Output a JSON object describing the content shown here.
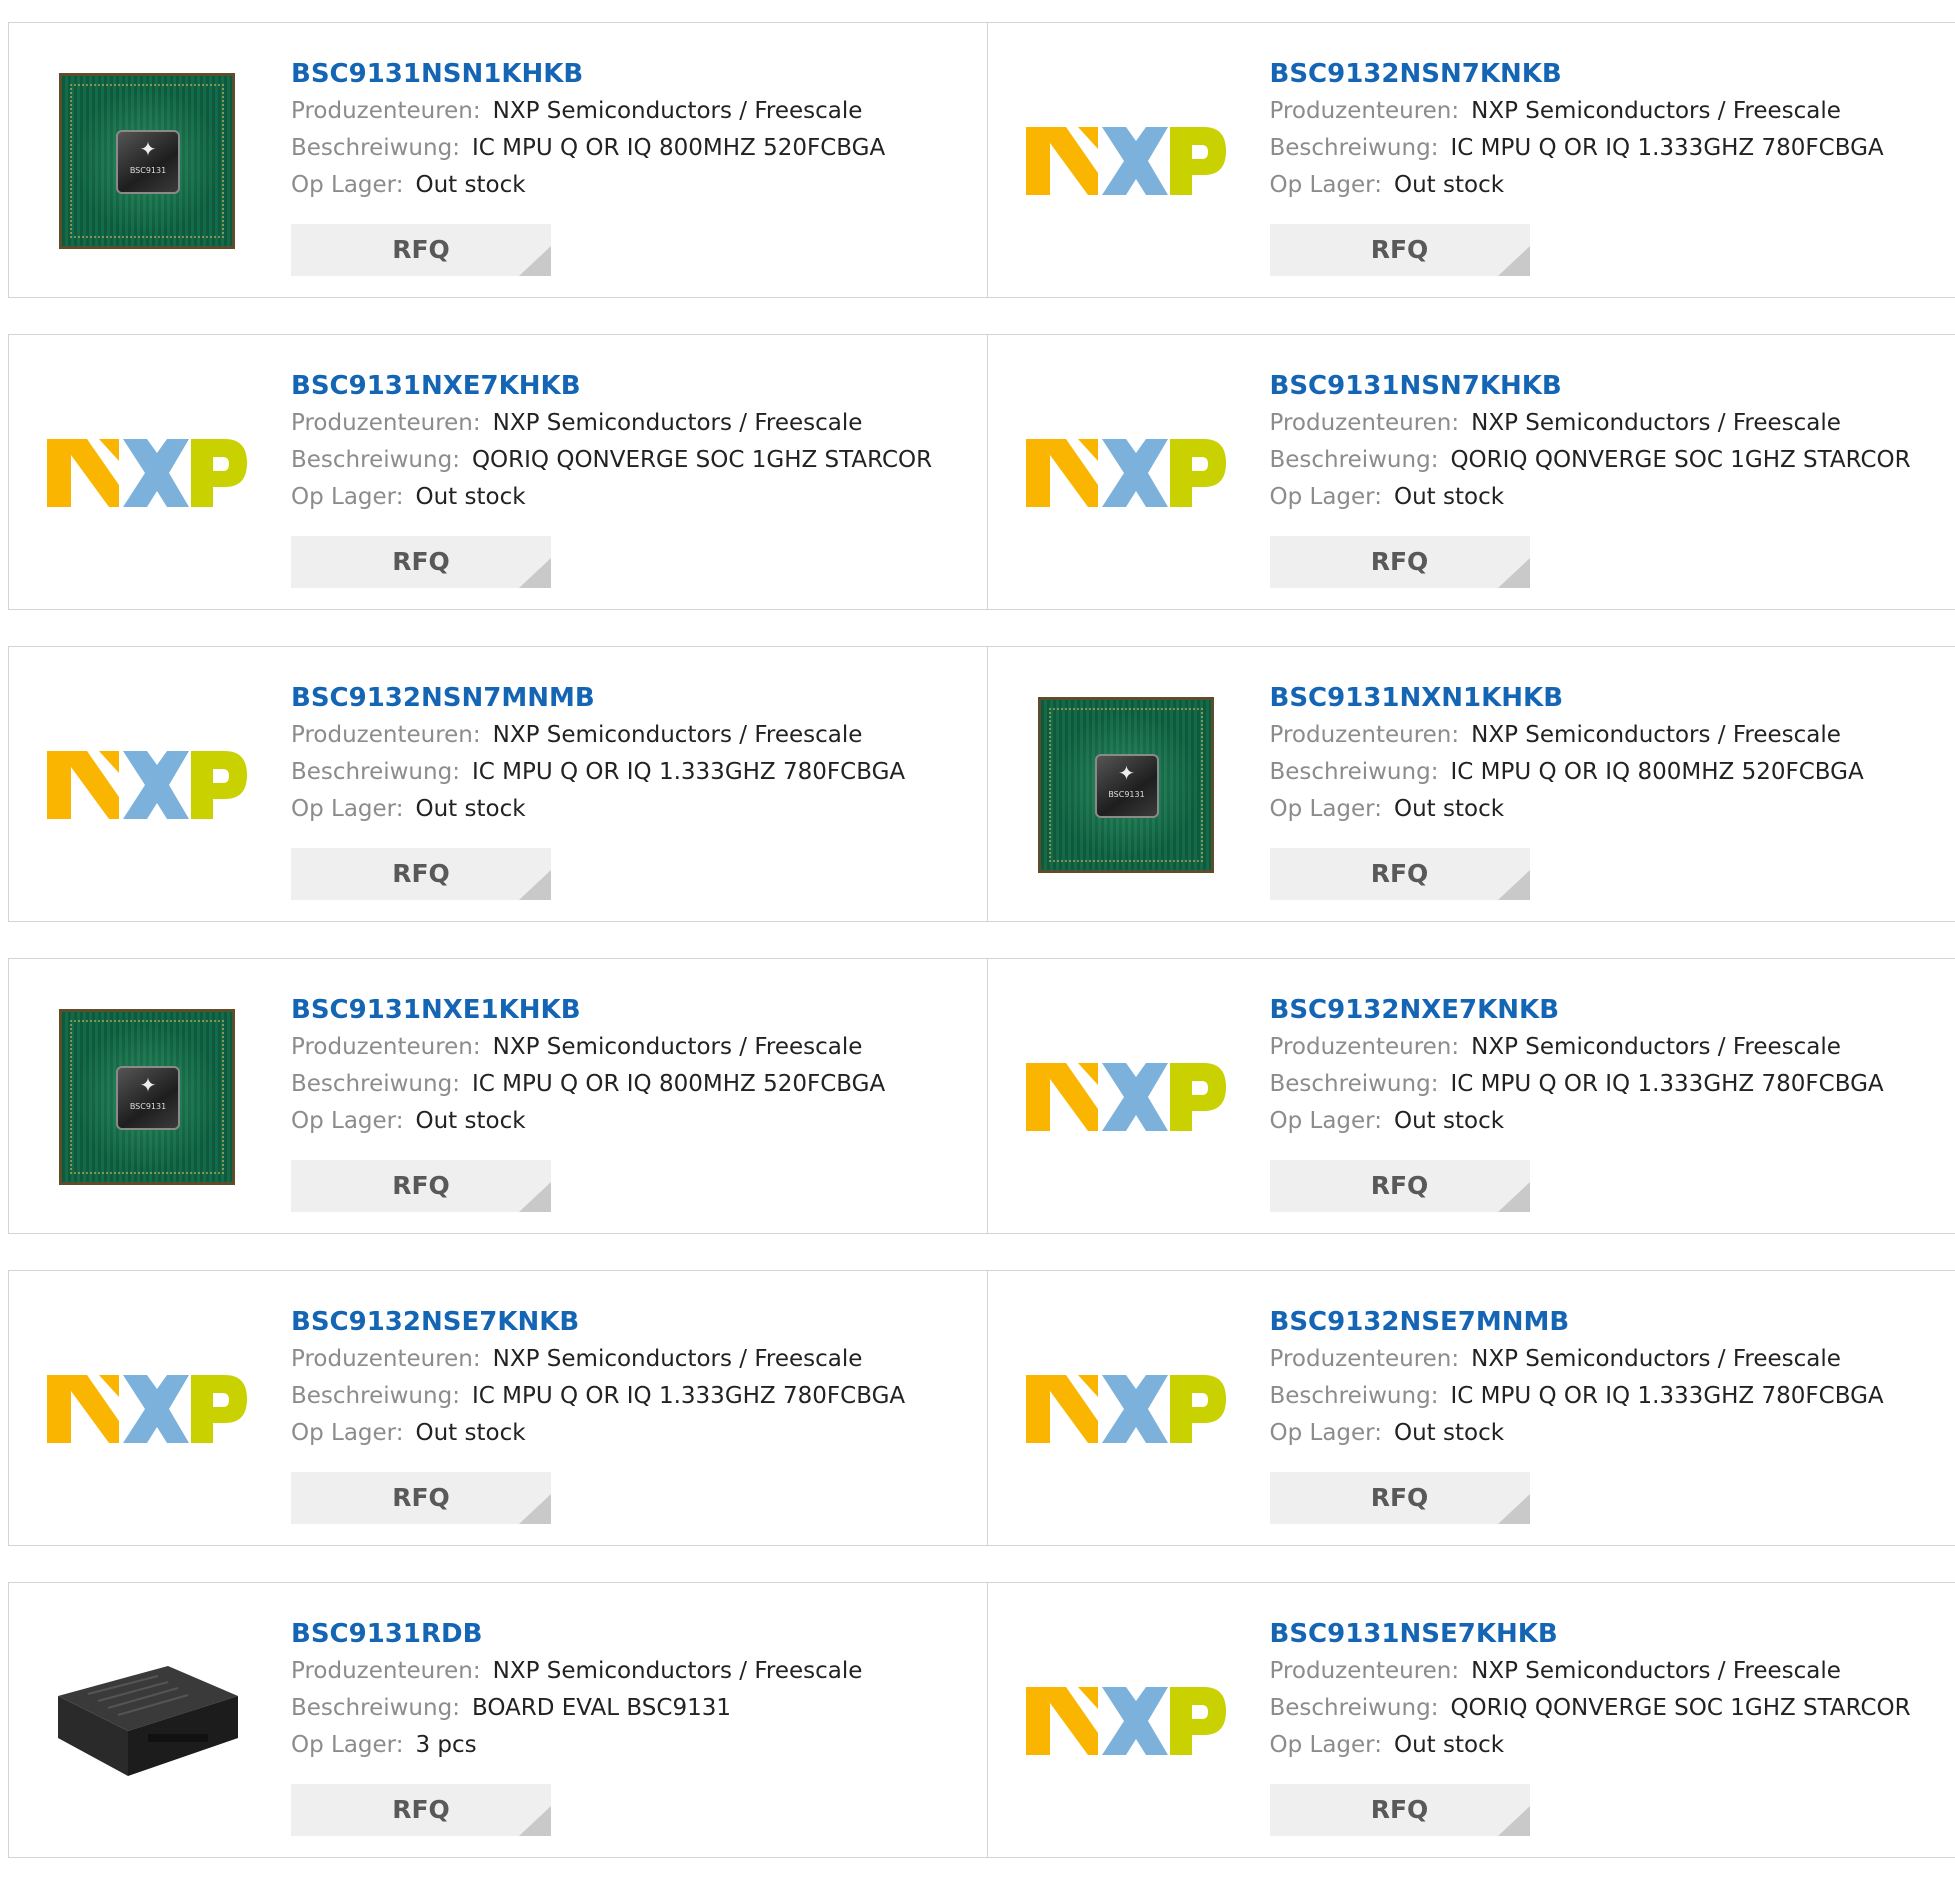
{
  "labels": {
    "manufacturer": "Produzenteuren:",
    "description": "Beschreiwung:",
    "stock": "Op Lager:",
    "rfq": "RFQ"
  },
  "chip_marking": "BSC9131",
  "products": [
    {
      "part": "BSC9131NSN1KHKB",
      "manufacturer": "NXP Semiconductors / Freescale",
      "description": "IC MPU Q OR IQ 800MHZ 520FCBGA",
      "stock": "Out stock",
      "image": "chip"
    },
    {
      "part": "BSC9132NSN7KNKB",
      "manufacturer": "NXP Semiconductors / Freescale",
      "description": "IC MPU Q OR IQ 1.333GHZ 780FCBGA",
      "stock": "Out stock",
      "image": "nxp-logo"
    },
    {
      "part": "BSC9131NXE7KHKB",
      "manufacturer": "NXP Semiconductors / Freescale",
      "description": "QORIQ QONVERGE SOC 1GHZ STARCOR",
      "stock": "Out stock",
      "image": "nxp-logo"
    },
    {
      "part": "BSC9131NSN7KHKB",
      "manufacturer": "NXP Semiconductors / Freescale",
      "description": "QORIQ QONVERGE SOC 1GHZ STARCOR",
      "stock": "Out stock",
      "image": "nxp-logo"
    },
    {
      "part": "BSC9132NSN7MNMB",
      "manufacturer": "NXP Semiconductors / Freescale",
      "description": "IC MPU Q OR IQ 1.333GHZ 780FCBGA",
      "stock": "Out stock",
      "image": "nxp-logo"
    },
    {
      "part": "BSC9131NXN1KHKB",
      "manufacturer": "NXP Semiconductors / Freescale",
      "description": "IC MPU Q OR IQ 800MHZ 520FCBGA",
      "stock": "Out stock",
      "image": "chip"
    },
    {
      "part": "BSC9131NXE1KHKB",
      "manufacturer": "NXP Semiconductors / Freescale",
      "description": "IC MPU Q OR IQ 800MHZ 520FCBGA",
      "stock": "Out stock",
      "image": "chip"
    },
    {
      "part": "BSC9132NXE7KNKB",
      "manufacturer": "NXP Semiconductors / Freescale",
      "description": "IC MPU Q OR IQ 1.333GHZ 780FCBGA",
      "stock": "Out stock",
      "image": "nxp-logo"
    },
    {
      "part": "BSC9132NSE7KNKB",
      "manufacturer": "NXP Semiconductors / Freescale",
      "description": "IC MPU Q OR IQ 1.333GHZ 780FCBGA",
      "stock": "Out stock",
      "image": "nxp-logo"
    },
    {
      "part": "BSC9132NSE7MNMB",
      "manufacturer": "NXP Semiconductors / Freescale",
      "description": "IC MPU Q OR IQ 1.333GHZ 780FCBGA",
      "stock": "Out stock",
      "image": "nxp-logo"
    },
    {
      "part": "BSC9131RDB",
      "manufacturer": "NXP Semiconductors / Freescale",
      "description": "BOARD EVAL BSC9131",
      "stock": "3 pcs",
      "image": "eval-box"
    },
    {
      "part": "BSC9131NSE7KHKB",
      "manufacturer": "NXP Semiconductors / Freescale",
      "description": "QORIQ QONVERGE SOC 1GHZ STARCOR",
      "stock": "Out stock",
      "image": "nxp-logo"
    }
  ],
  "colors": {
    "link": "#1565b5",
    "label": "#8c8c8c",
    "rfq_bg": "#efefef",
    "nxp_orange": "#f9b500",
    "nxp_blue": "#7bb1db",
    "nxp_green": "#c9d200"
  }
}
